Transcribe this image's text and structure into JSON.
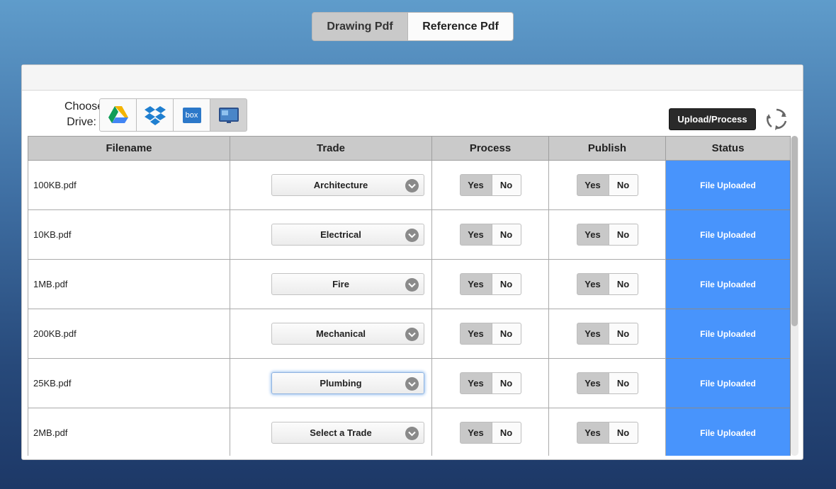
{
  "tabs": [
    {
      "label": "Drawing Pdf"
    },
    {
      "label": "Reference Pdf"
    }
  ],
  "drive_chooser": {
    "label_line1": "Choose",
    "label_line2": "Drive:",
    "drives": [
      {
        "icon": "google-drive-icon"
      },
      {
        "icon": "dropbox-icon"
      },
      {
        "icon": "box-icon",
        "text": "box"
      },
      {
        "icon": "local-computer-icon"
      }
    ]
  },
  "upload_button": {
    "label": "Upload/Process"
  },
  "table": {
    "columns": [
      "Filename",
      "Trade",
      "Process",
      "Publish",
      "Status"
    ],
    "rows": [
      {
        "filename": "100KB.pdf",
        "trade": "Architecture",
        "process_yes": "Yes",
        "process_no": "No",
        "publish_yes": "Yes",
        "publish_no": "No",
        "status": "File Uploaded"
      },
      {
        "filename": "10KB.pdf",
        "trade": "Electrical",
        "process_yes": "Yes",
        "process_no": "No",
        "publish_yes": "Yes",
        "publish_no": "No",
        "status": "File Uploaded"
      },
      {
        "filename": "1MB.pdf",
        "trade": "Fire",
        "process_yes": "Yes",
        "process_no": "No",
        "publish_yes": "Yes",
        "publish_no": "No",
        "status": "File Uploaded"
      },
      {
        "filename": "200KB.pdf",
        "trade": "Mechanical",
        "process_yes": "Yes",
        "process_no": "No",
        "publish_yes": "Yes",
        "publish_no": "No",
        "status": "File Uploaded"
      },
      {
        "filename": "25KB.pdf",
        "trade": "Plumbing",
        "process_yes": "Yes",
        "process_no": "No",
        "publish_yes": "Yes",
        "publish_no": "No",
        "status": "File Uploaded"
      },
      {
        "filename": "2MB.pdf",
        "trade": "Select a Trade",
        "process_yes": "Yes",
        "process_no": "No",
        "publish_yes": "Yes",
        "publish_no": "No",
        "status": "File Uploaded"
      }
    ]
  },
  "colors": {
    "status_bg": "#4894fc",
    "upload_button_bg": "#2a2a2a",
    "header_bg": "#cacaca"
  }
}
